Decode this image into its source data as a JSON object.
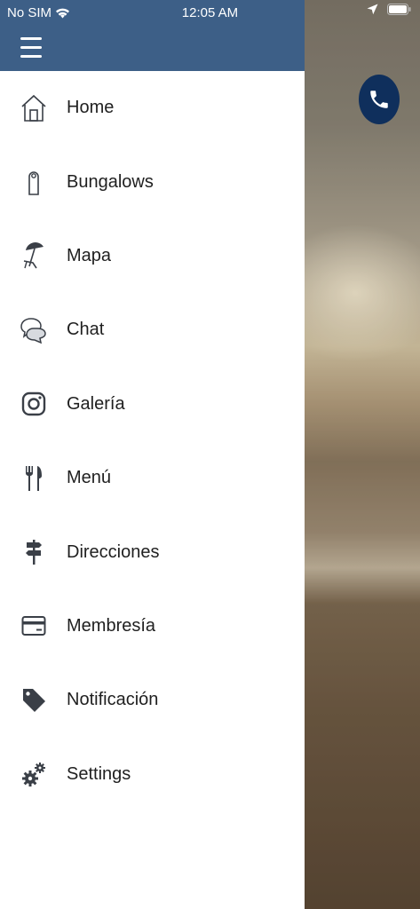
{
  "status_bar": {
    "carrier": "No SIM",
    "time": "12:05 AM"
  },
  "drawer": {
    "items": [
      {
        "label": "Home",
        "icon": "home-icon"
      },
      {
        "label": "Bungalows",
        "icon": "door-hanger-icon"
      },
      {
        "label": "Mapa",
        "icon": "beach-umbrella-icon"
      },
      {
        "label": "Chat",
        "icon": "chat-bubbles-icon"
      },
      {
        "label": "Galería",
        "icon": "instagram-icon"
      },
      {
        "label": "Menú",
        "icon": "fork-knife-icon"
      },
      {
        "label": "Direcciones",
        "icon": "signpost-icon"
      },
      {
        "label": "Membresía",
        "icon": "credit-card-icon"
      },
      {
        "label": "Notificación",
        "icon": "tag-icon"
      },
      {
        "label": "Settings",
        "icon": "gears-icon"
      }
    ]
  },
  "colors": {
    "header": "#3d5f87",
    "call_button": "#0f2f5c",
    "icon": "#3a3f47"
  }
}
